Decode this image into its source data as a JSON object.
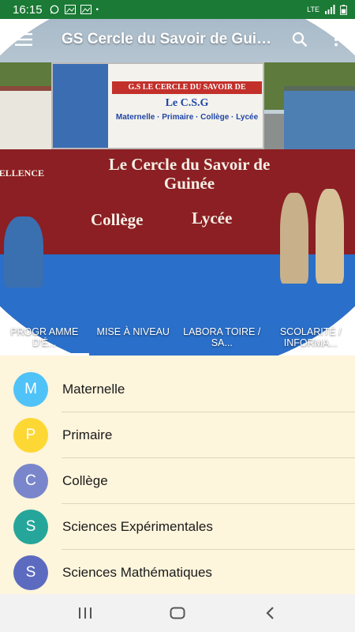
{
  "status_bar": {
    "time": "16:15",
    "network": "LTE"
  },
  "toolbar": {
    "title": "GS  Cercle du Savoir  de Guinée",
    "menu_icon": "hamburger-menu-icon",
    "search_icon": "search-icon",
    "more_icon": "more-vert-icon"
  },
  "hero": {
    "billboard_title": "G.S LE CERCLE DU SAVOIR DE GUINEE",
    "billboard_csg": "Le C.S.G",
    "billboard_levels": "Maternelle · Primaire · Collège · Lycée",
    "wall_line1": "Le Cercle du Savoir de Guinée",
    "wall_college": "Collège",
    "wall_lycee": "Lycée",
    "wall_excellence": "CELLENCE"
  },
  "tabs": [
    {
      "label": "PROGR AMME D'É...",
      "active": true
    },
    {
      "label": "MISE À NIVEAU",
      "active": false
    },
    {
      "label": "LABORA TOIRE / SA...",
      "active": false
    },
    {
      "label": "SCOLARITÉ / INFORMA...",
      "active": false
    }
  ],
  "list": [
    {
      "letter": "M",
      "label": "Maternelle",
      "color": "#4fc3f7"
    },
    {
      "letter": "P",
      "label": "Primaire",
      "color": "#fdd835"
    },
    {
      "letter": "C",
      "label": "Collège",
      "color": "#7986cb"
    },
    {
      "letter": "S",
      "label": "Sciences Expérimentales",
      "color": "#26a69a"
    },
    {
      "letter": "S",
      "label": "Sciences Mathématiques",
      "color": "#5c6bc0"
    }
  ],
  "colors": {
    "status_bar": "#1b7a35",
    "list_background": "#fdf5dc"
  }
}
